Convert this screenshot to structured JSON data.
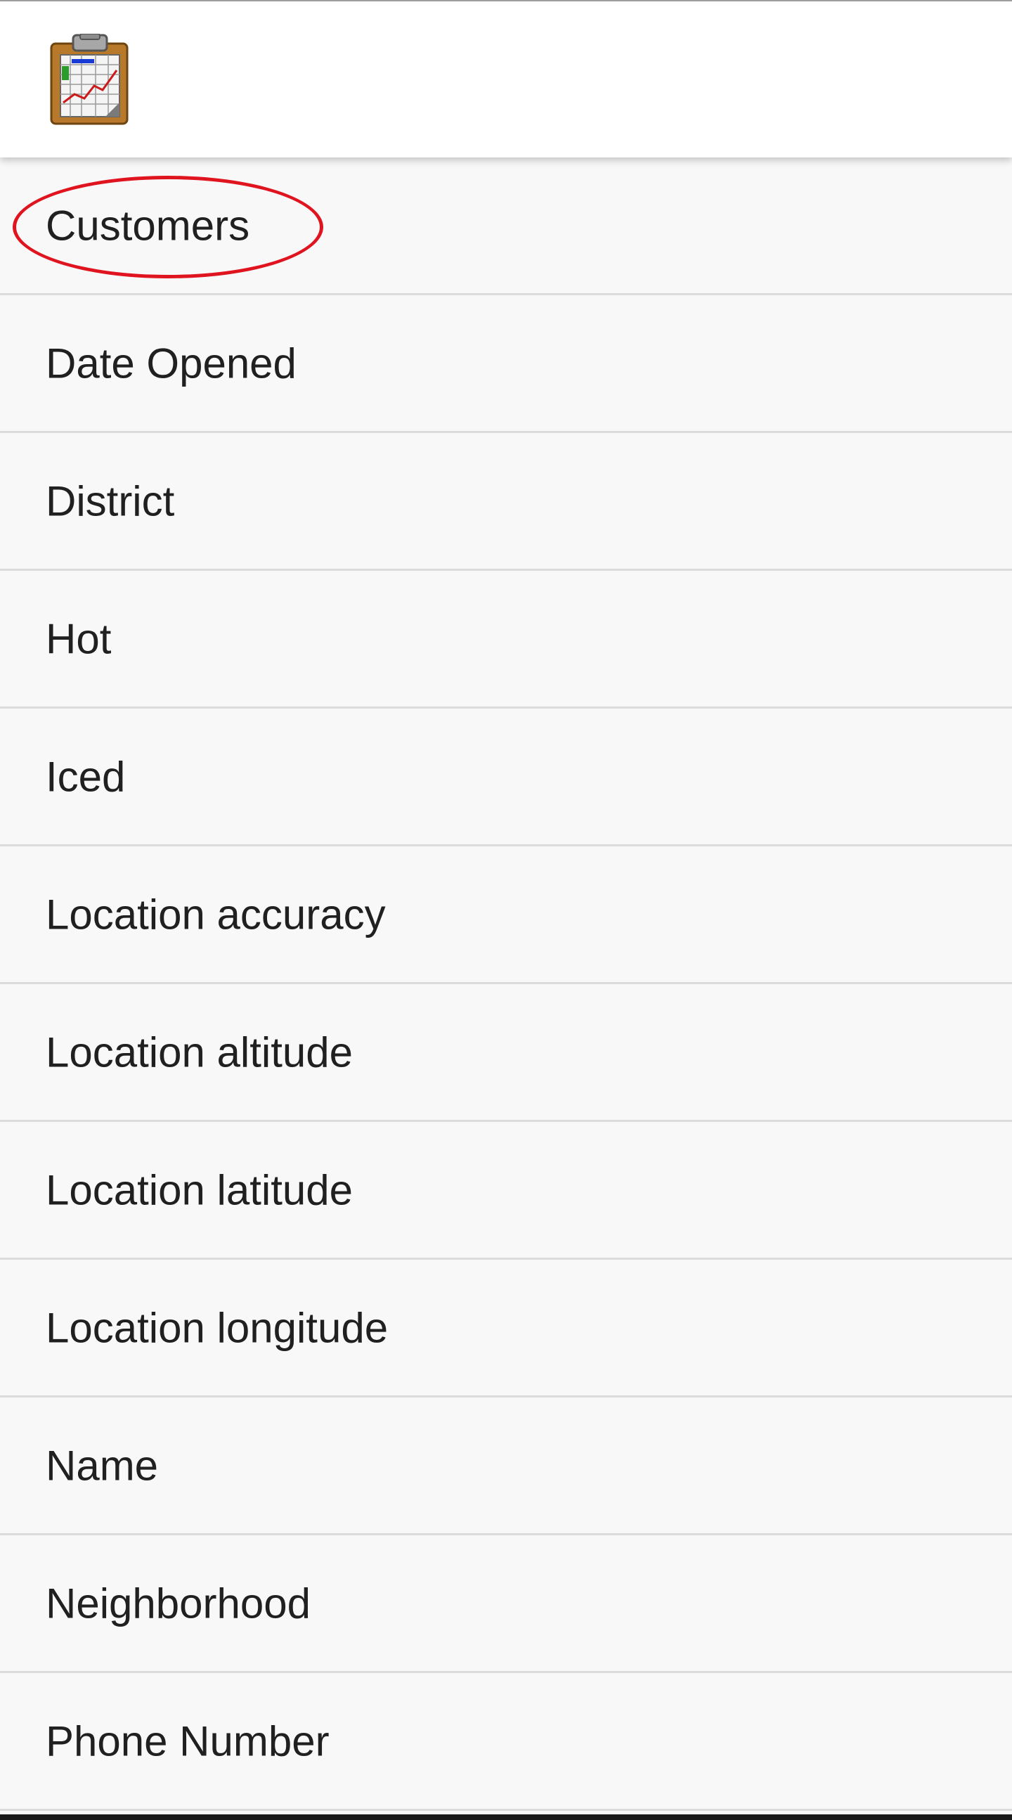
{
  "app_bar": {
    "icon": "clipboard-spreadsheet-icon"
  },
  "highlight_color": "#e0141e",
  "fields": [
    {
      "label": "Customers",
      "highlighted": true
    },
    {
      "label": "Date Opened"
    },
    {
      "label": "District"
    },
    {
      "label": "Hot"
    },
    {
      "label": "Iced"
    },
    {
      "label": "Location accuracy"
    },
    {
      "label": "Location altitude"
    },
    {
      "label": "Location latitude"
    },
    {
      "label": "Location longitude"
    },
    {
      "label": "Name"
    },
    {
      "label": "Neighborhood"
    },
    {
      "label": "Phone Number"
    }
  ]
}
